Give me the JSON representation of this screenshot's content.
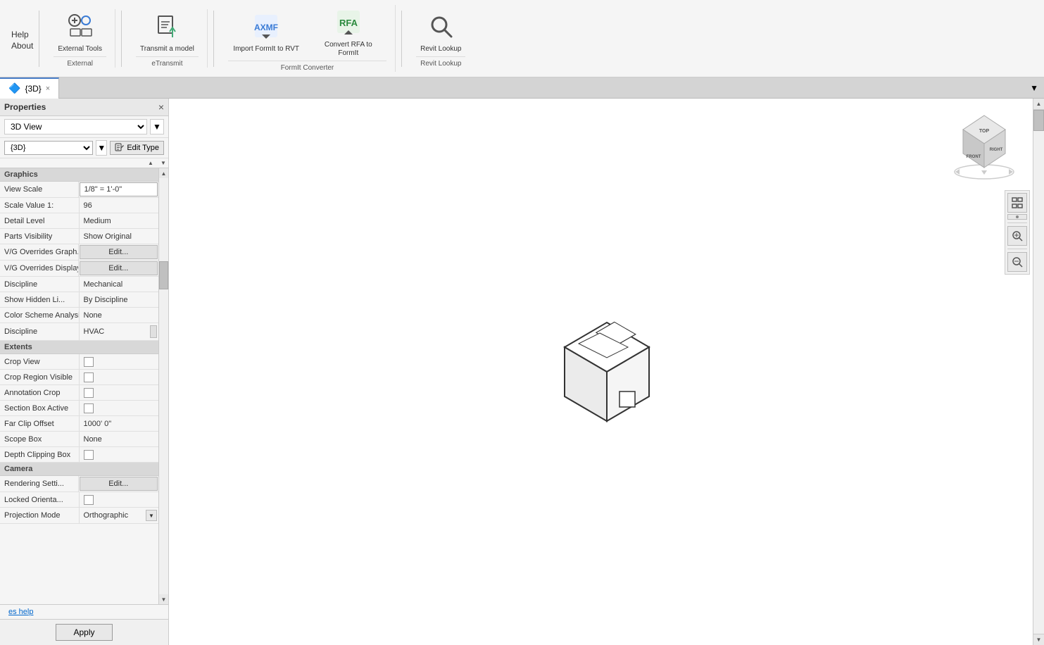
{
  "toolbar": {
    "groups": [
      {
        "label": "External",
        "items": [
          {
            "id": "external-tools",
            "icon": "⚙",
            "label": "External\nTools"
          }
        ]
      },
      {
        "label": "eTransmit",
        "items": [
          {
            "id": "transmit-model",
            "icon": "📤",
            "label": "Transmit a model"
          }
        ]
      },
      {
        "label": "FormIt Converter",
        "items": [
          {
            "id": "import-formit",
            "icon": "⬇",
            "label": "Import FormIt\nto RVT"
          },
          {
            "id": "convert-rfa",
            "icon": "⬆",
            "label": "Convert RFA\nto FormIt"
          }
        ]
      },
      {
        "label": "Revit Lookup",
        "items": [
          {
            "id": "revit-lookup",
            "icon": "🔍",
            "label": "Revit Lookup"
          }
        ]
      }
    ],
    "help_label": "Help",
    "about_label": "About"
  },
  "tabs": [
    {
      "id": "3d-view",
      "label": "{3D}",
      "active": true,
      "closeable": true,
      "icon": "🔷"
    }
  ],
  "panel": {
    "title": "Properties",
    "close_icon": "×",
    "view_type": "3D View",
    "instance_value": "{3D}",
    "edit_type_label": "Edit Type",
    "properties": {
      "graphics_section": "Graphics",
      "extents_section": "Extents",
      "camera_section": "Camera",
      "rows": [
        {
          "label": "View Scale",
          "value": "1/8\" = 1'-0\"",
          "type": "editable"
        },
        {
          "label": "Scale Value  1:",
          "value": "96",
          "type": "text"
        },
        {
          "label": "Detail Level",
          "value": "Medium",
          "type": "text"
        },
        {
          "label": "Parts Visibility",
          "value": "Show Original",
          "type": "text"
        },
        {
          "label": "V/G Overrides Graph...",
          "value": "Edit...",
          "type": "button"
        },
        {
          "label": "V/G Overrides Display...",
          "value": "Edit...",
          "type": "button"
        },
        {
          "label": "Discipline",
          "value": "Mechanical",
          "type": "text"
        },
        {
          "label": "Show Hidden Li...",
          "value": "By Discipline",
          "type": "text"
        },
        {
          "label": "Color Scheme Analysis...",
          "value": "None",
          "type": "text"
        },
        {
          "label": "Discipline",
          "value": "HVAC",
          "type": "text_scroll"
        }
      ],
      "extents_rows": [
        {
          "label": "Crop View",
          "value": "",
          "type": "checkbox",
          "checked": false
        },
        {
          "label": "Crop Region Visible",
          "value": "",
          "type": "checkbox",
          "checked": false
        },
        {
          "label": "Annotation Crop",
          "value": "",
          "type": "checkbox_label",
          "checked": false
        },
        {
          "label": "Section Box Active",
          "value": "",
          "type": "checkbox_label",
          "checked": false
        },
        {
          "label": "Far Clip Offset",
          "value": "1000'  0\"",
          "type": "text"
        },
        {
          "label": "Scope Box",
          "value": "None",
          "type": "text"
        },
        {
          "label": "Depth Clipping Box",
          "value": "",
          "type": "checkbox",
          "checked": false
        }
      ],
      "camera_rows": [
        {
          "label": "Rendering Setti...",
          "value": "Edit...",
          "type": "button"
        },
        {
          "label": "Locked Orienta...",
          "value": "",
          "type": "checkbox",
          "checked": false
        },
        {
          "label": "Projection Mode",
          "value": "Orthographic",
          "type": "text_dropdown"
        }
      ]
    },
    "apply_label": "Apply",
    "help_label": "es help"
  },
  "viewport": {
    "background": "#ffffff"
  },
  "navcube": {
    "top_label": "TOP",
    "front_label": "FRONT",
    "right_label": "RIGHT"
  }
}
